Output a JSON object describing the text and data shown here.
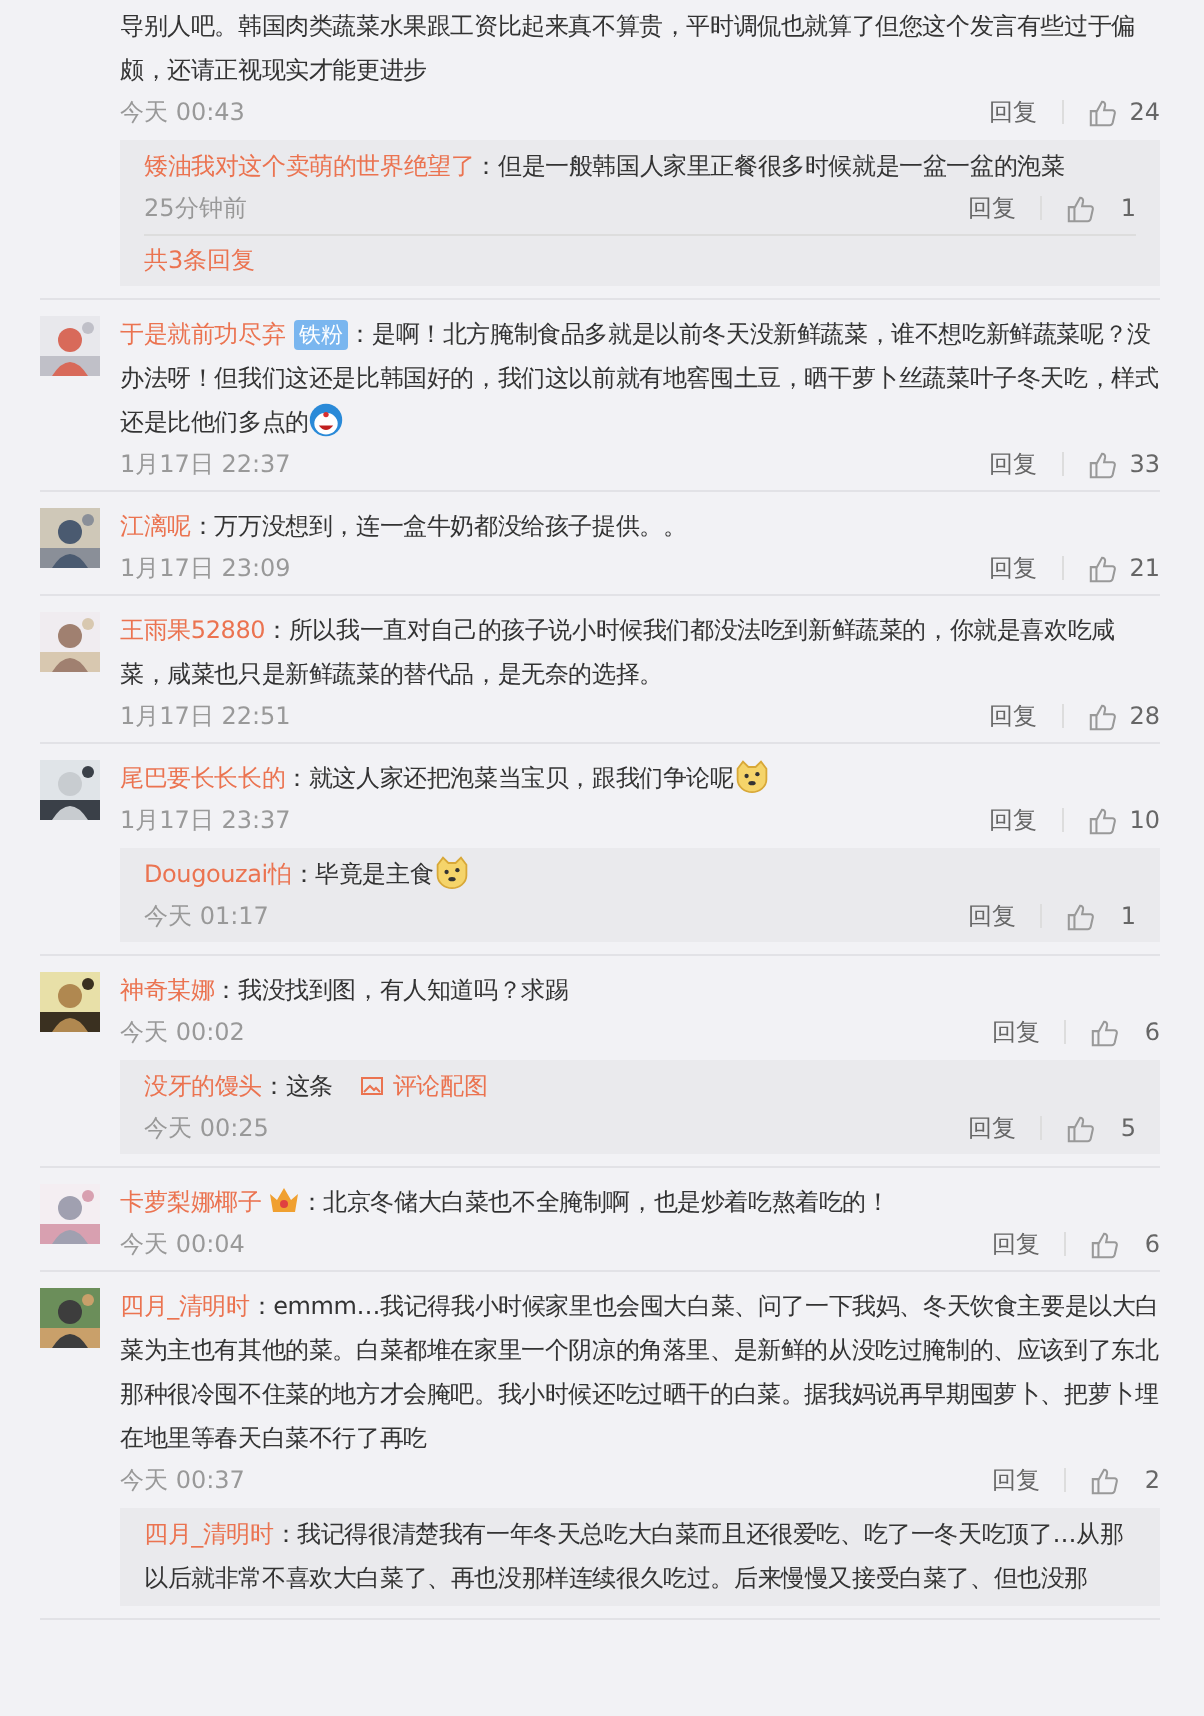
{
  "comments": [
    {
      "text": "导别人吧。韩国肉类蔬菜水果跟工资比起来真不算贵，平时调侃也就算了但您这个发言有些过于偏颇，还请正视现实才能更进步",
      "time": "今天 00:43",
      "reply": "回复",
      "likes": "24",
      "replies": [
        {
          "name": "矮油我对这个卖萌的世界绝望了",
          "text": "：但是一般韩国人家里正餐很多时候就是一盆一盆的泡菜",
          "time": "25分钟前",
          "reply": "回复",
          "likes": "1"
        }
      ],
      "more": "共3条回复"
    },
    {
      "name": "于是就前功尽弃",
      "badge": "铁粉",
      "text": "：是啊！北方腌制食品多就是以前冬天没新鲜蔬菜，谁不想吃新鲜蔬菜呢？没办法呀！但我们这还是比韩国好的，我们这以前就有地窖囤土豆，晒干萝卜丝蔬菜叶子冬天吃，样式还是比他们多点的",
      "emoji": {
        "kind": "robot"
      },
      "time": "1月17日 22:37",
      "reply": "回复",
      "likes": "33"
    },
    {
      "name": "江漓呢",
      "text": "：万万没想到，连一盒牛奶都没给孩子提供。。",
      "time": "1月17日 23:09",
      "reply": "回复",
      "likes": "21"
    },
    {
      "name": "王雨果52880",
      "text": "：所以我一直对自己的孩子说小时候我们都没法吃到新鲜蔬菜的，你就是喜欢吃咸菜，咸菜也只是新鲜蔬菜的替代品，是无奈的选择。",
      "time": "1月17日 22:51",
      "reply": "回复",
      "likes": "28"
    },
    {
      "name": "尾巴要长长长的",
      "text": "：就这人家还把泡菜当宝贝，跟我们争论呢",
      "emoji": {
        "kind": "doge"
      },
      "time": "1月17日 23:37",
      "reply": "回复",
      "likes": "10",
      "replies": [
        {
          "name": "Dougouzai怕",
          "text": "：毕竟是主食",
          "emoji": {
            "kind": "doge"
          },
          "time": "今天 01:17",
          "reply": "回复",
          "likes": "1"
        }
      ]
    },
    {
      "name": "神奇某娜",
      "text": "：我没找到图，有人知道吗？求踢",
      "time": "今天 00:02",
      "reply": "回复",
      "likes": "6",
      "replies": [
        {
          "name": "没牙的馒头",
          "text": "：这条",
          "link": "评论配图",
          "time": "今天 00:25",
          "reply": "回复",
          "likes": "5"
        }
      ]
    },
    {
      "name": "卡萝梨娜椰子",
      "name_icon": {
        "kind": "crown"
      },
      "text": "：北京冬储大白菜也不全腌制啊，也是炒着吃熬着吃的！",
      "time": "今天 00:04",
      "reply": "回复",
      "likes": "6"
    },
    {
      "name": "四月_清明时",
      "text": "：emmm…我记得我小时候家里也会囤大白菜、问了一下我妈、冬天饮食主要是以大白菜为主也有其他的菜。白菜都堆在家里一个阴凉的角落里、是新鲜的从没吃过腌制的、应该到了东北那种很冷囤不住菜的地方才会腌吧。我小时候还吃过晒干的白菜。据我妈说再早期囤萝卜、把萝卜埋在地里等春天白菜不行了再吃",
      "time": "今天 00:37",
      "reply": "回复",
      "likes": "2",
      "replies": [
        {
          "name": "四月_清明时",
          "text": "：我记得很清楚我有一年冬天总吃大白菜而且还很爱吃、吃了一冬天吃顶了…从那以后就非常不喜欢大白菜了、再也没那样连续很久吃过。后来慢慢又接受白菜了、但也没那"
        }
      ]
    }
  ]
}
